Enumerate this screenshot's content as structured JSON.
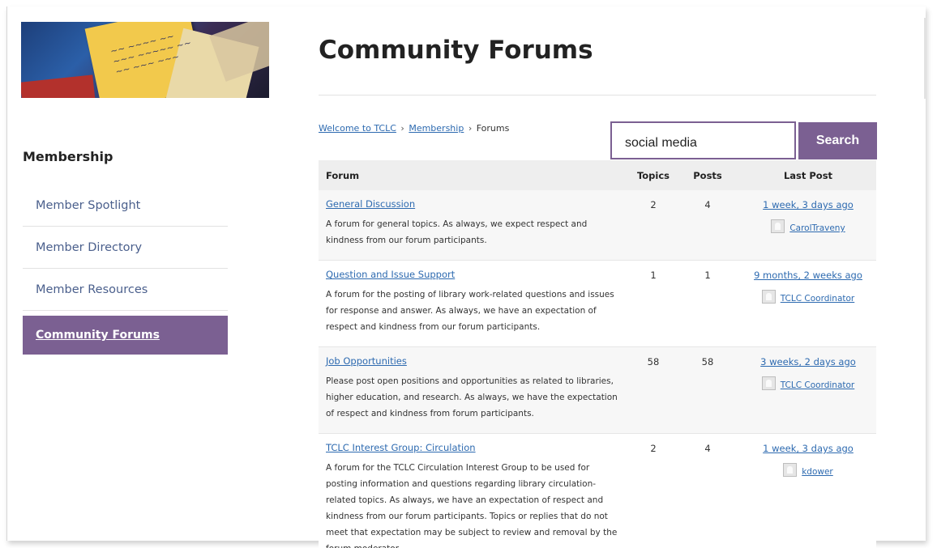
{
  "sidebar": {
    "heading": "Membership",
    "items": [
      {
        "label": "Member Spotlight",
        "active": false
      },
      {
        "label": "Member Directory",
        "active": false
      },
      {
        "label": "Member Resources",
        "active": false
      },
      {
        "label": "Community Forums",
        "active": true
      }
    ]
  },
  "page": {
    "title": "Community Forums"
  },
  "breadcrumb": {
    "items": [
      "Welcome to TCLC",
      "Membership",
      "Forums"
    ],
    "separator": "›"
  },
  "search": {
    "value": "social media",
    "button_label": "Search"
  },
  "table": {
    "headers": {
      "forum": "Forum",
      "topics": "Topics",
      "posts": "Posts",
      "last_post": "Last Post"
    },
    "rows": [
      {
        "title": "General Discussion",
        "description": "A forum for general topics. As always, we expect respect and kindness from our forum participants.",
        "topics": "2",
        "posts": "4",
        "last_post": "1 week, 3 days ago",
        "author": "CarolTraveny"
      },
      {
        "title": "Question and Issue Support",
        "description": "A forum for the posting of library work-related questions and issues for response and answer. As always, we have an expectation of respect and kindness from our forum participants.",
        "topics": "1",
        "posts": "1",
        "last_post": "9 months, 2 weeks ago",
        "author": "TCLC Coordinator"
      },
      {
        "title": "Job Opportunities",
        "description": "Please post open positions and opportunities as related to libraries, higher education, and research. As always, we have the expectation of respect and kindness from forum participants.",
        "topics": "58",
        "posts": "58",
        "last_post": "3 weeks, 2 days ago",
        "author": "TCLC Coordinator"
      },
      {
        "title": "TCLC Interest Group: Circulation",
        "description": "A forum for the TCLC Circulation Interest Group to be used for posting information and questions regarding library circulation-related topics. As always, we have an expectation of respect and kindness from our forum participants. Topics or replies that do not meet that expectation may be subject to review and removal by the forum moderator.",
        "topics": "2",
        "posts": "4",
        "last_post": "1 week, 3 days ago",
        "author": "kdower"
      }
    ]
  },
  "colors": {
    "accent": "#7b6092",
    "link": "#2d6ab0"
  }
}
